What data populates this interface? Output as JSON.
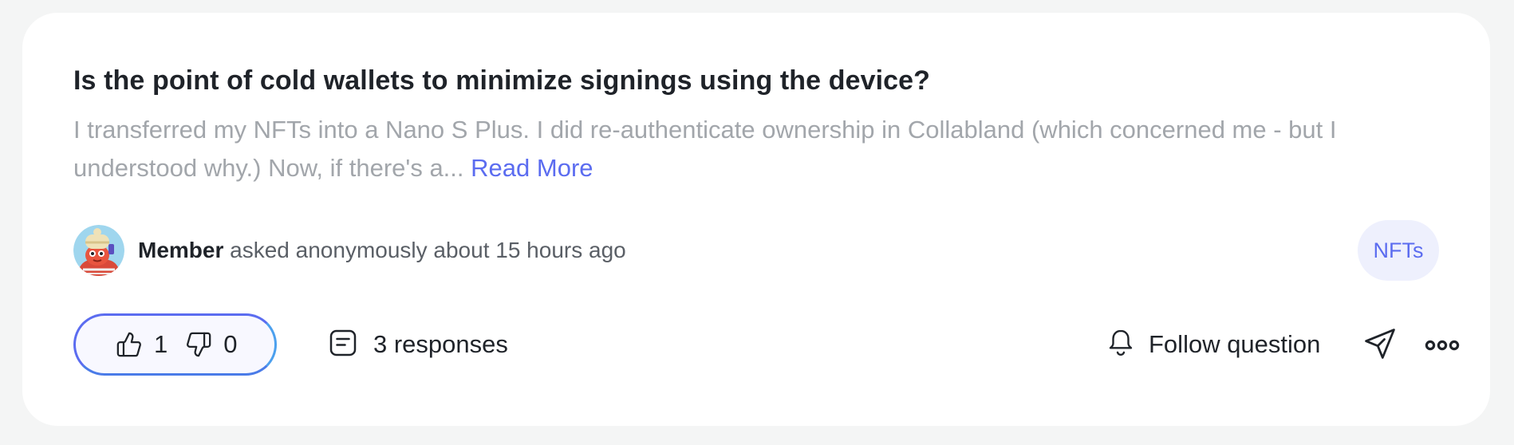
{
  "question": {
    "title": "Is the point of cold wallets to minimize signings using the device?",
    "excerpt_line1": "I transferred my NFTs into a Nano S Plus. I did re-authenticate ownership in Collabland (which concerned me - but I",
    "excerpt_line2": "understood why.) Now, if there's a...",
    "read_more_label": "Read More"
  },
  "author": {
    "name": "Member",
    "meta": "asked anonymously about 15 hours ago",
    "avatar_icon": "cartoon-avatar"
  },
  "tag": {
    "label": "NFTs"
  },
  "votes": {
    "upvote_icon": "thumbs-up-icon",
    "upvotes": "1",
    "downvote_icon": "thumbs-down-icon",
    "downvotes": "0"
  },
  "actions": {
    "responses_icon": "message-icon",
    "responses_label": "3 responses",
    "follow_icon": "bell-icon",
    "follow_label": "Follow question",
    "share_icon": "paper-plane-icon",
    "more_icon": "ellipsis-icon"
  },
  "colors": {
    "accent": "#5b6cf0",
    "tag_background": "#eef0fd",
    "title_text": "#1f2329",
    "muted_text": "#a2a6ab"
  }
}
